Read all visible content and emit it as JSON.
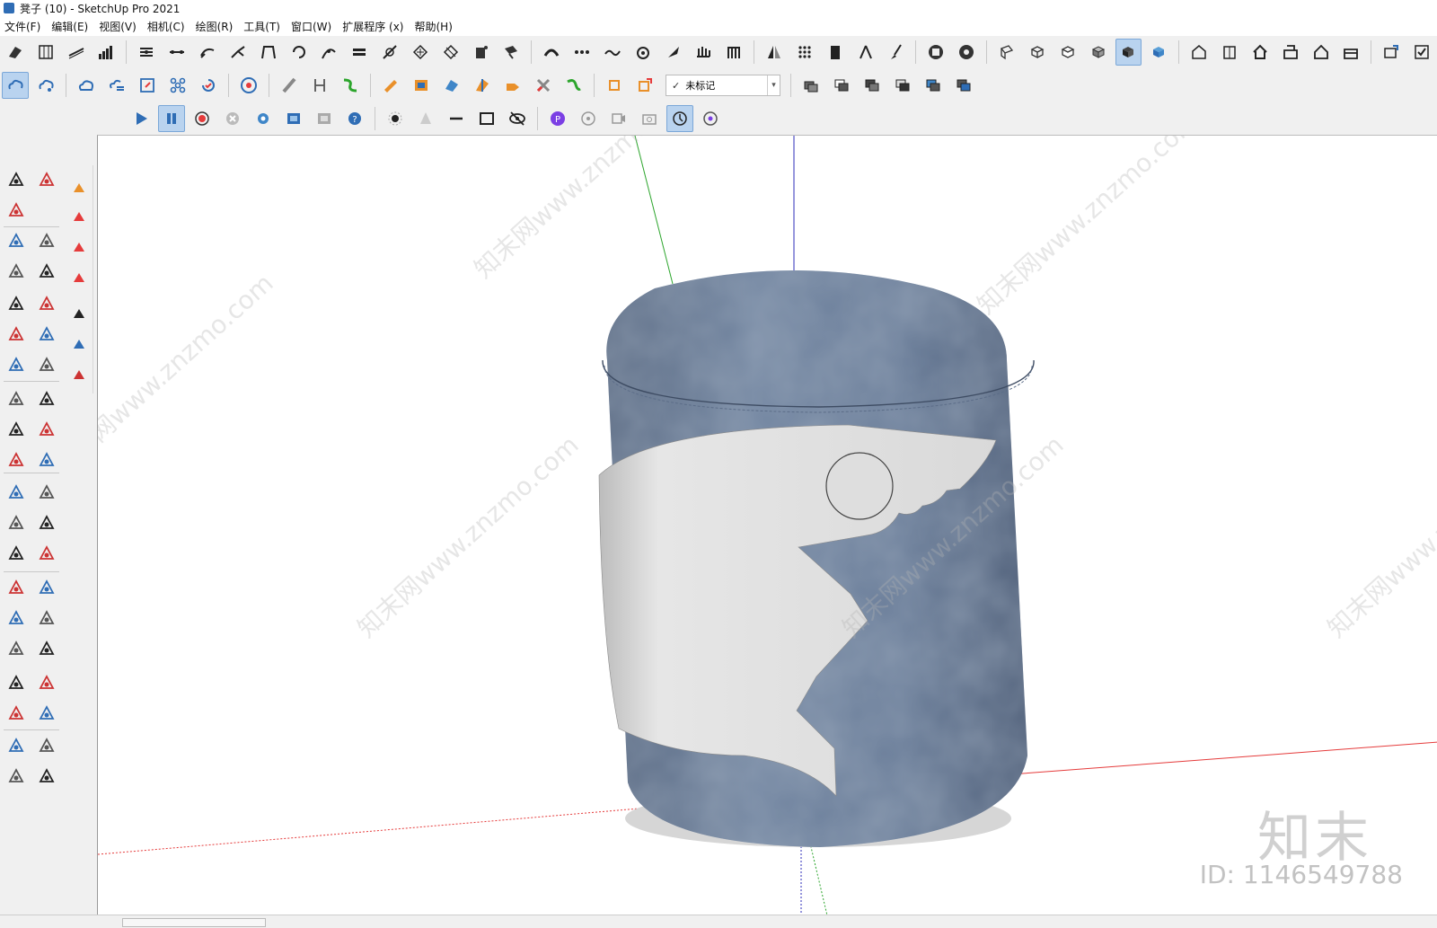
{
  "window": {
    "title": "凳子 (10) - SketchUp Pro 2021"
  },
  "menu": [
    {
      "label": "文件(F)"
    },
    {
      "label": "编辑(E)"
    },
    {
      "label": "视图(V)"
    },
    {
      "label": "相机(C)"
    },
    {
      "label": "绘图(R)"
    },
    {
      "label": "工具(T)"
    },
    {
      "label": "窗口(W)"
    },
    {
      "label": "扩展程序 (x)"
    },
    {
      "label": "帮助(H)"
    }
  ],
  "toolbar2": {
    "tag_dropdown_value": "未标记",
    "tag_check": "✓"
  },
  "model": {
    "object": "stool",
    "colors": {
      "fabric": "#6e819c",
      "fabric_dark": "#4c5d78",
      "panel": "#e4e4e4",
      "axis_red": "#e53b3b",
      "axis_green": "#2ca52c",
      "axis_blue": "#2d2db8"
    }
  },
  "watermark": {
    "text": "知末网www.znzmo.com",
    "brand": "知末",
    "id_label": "ID: 1146549788"
  },
  "colors": {
    "selected_button": "#b9d3ef",
    "background": "#f0f0f0"
  }
}
